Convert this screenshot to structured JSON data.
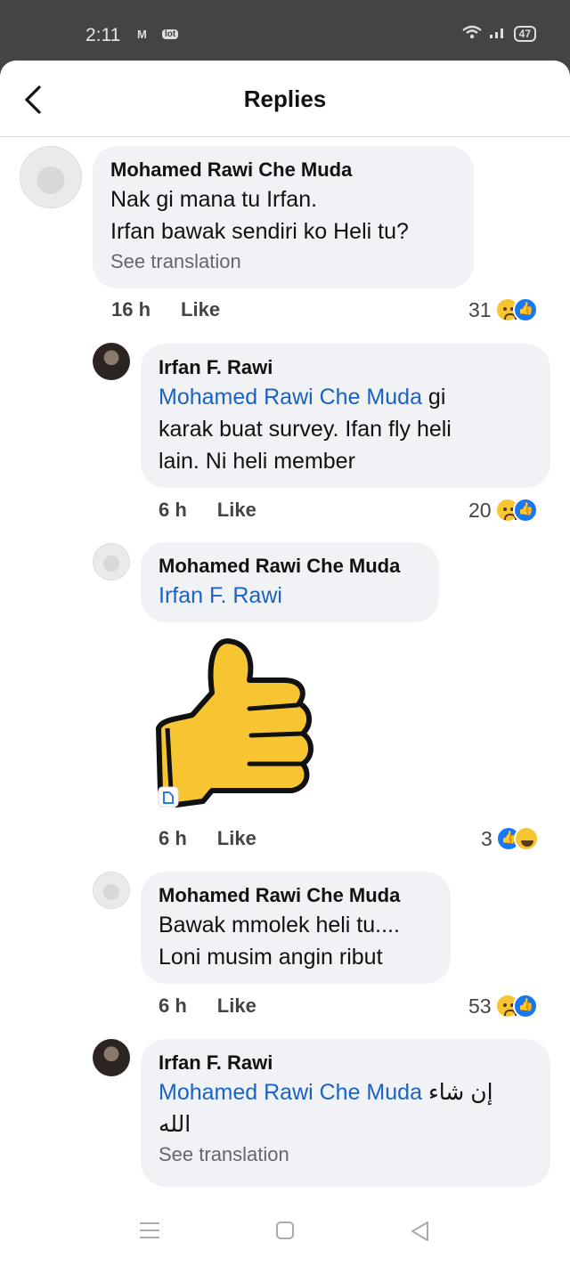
{
  "status": {
    "time": "2:11",
    "gmail_icon": "M",
    "app_icon": "lot",
    "battery": "47"
  },
  "header": {
    "title": "Replies"
  },
  "comments": [
    {
      "name": "Mohamed Rawi Che Muda",
      "lines": [
        "Nak gi mana tu Irfan.",
        "Irfan bawak sendiri ko Heli tu?"
      ],
      "translation": "See translation",
      "time": "16 h",
      "like": "Like",
      "count": "31"
    },
    {
      "name": "Irfan F. Rawi",
      "mention": "Mohamed Rawi Che Muda",
      "line1_rest": " gi",
      "lines": [
        "karak buat survey. Ifan fly heli",
        "lain. Ni heli member"
      ],
      "time": "6 h",
      "like": "Like",
      "count": "20"
    },
    {
      "name": "Mohamed Rawi Che Muda",
      "mention": "Irfan F. Rawi",
      "time": "6 h",
      "like": "Like",
      "count": "3"
    },
    {
      "name": "Mohamed Rawi Che Muda",
      "lines": [
        "Bawak mmolek heli tu....",
        "Loni musim angin ribut"
      ],
      "time": "6 h",
      "like": "Like",
      "count": "53"
    },
    {
      "name": "Irfan F. Rawi",
      "mention": "Mohamed Rawi Che Muda",
      "line1_rest": " إن شاء",
      "line2": "الله",
      "translation": "See translation"
    }
  ],
  "icons": {
    "back": "back-arrow",
    "sticker": "thumbs-up-sticker",
    "nav_menu": "menu",
    "nav_home": "square",
    "nav_back": "triangle-back"
  }
}
